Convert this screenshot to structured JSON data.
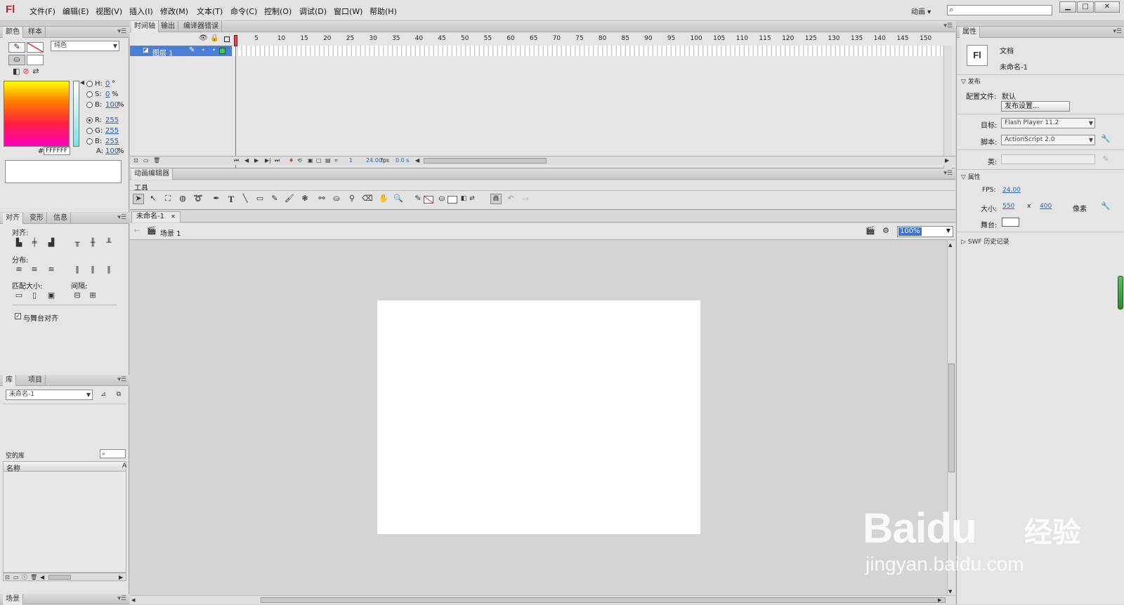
{
  "app": {
    "logo": "Fl"
  },
  "menus": [
    "文件(F)",
    "编辑(E)",
    "视图(V)",
    "插入(I)",
    "修改(M)",
    "文本(T)",
    "命令(C)",
    "控制(O)",
    "调试(D)",
    "窗口(W)",
    "帮助(H)"
  ],
  "workspace": {
    "mode": "动画 ▾"
  },
  "color_panel": {
    "tabs": [
      "颜色",
      "样本"
    ],
    "fill_type": "纯色",
    "hsb": [
      {
        "label": "H:",
        "value": "0",
        "unit": "°"
      },
      {
        "label": "S:",
        "value": "0",
        "unit": "%"
      },
      {
        "label": "B:",
        "value": "100",
        "unit": "%"
      }
    ],
    "rgb": [
      {
        "label": "R:",
        "value": "255"
      },
      {
        "label": "G:",
        "value": "255"
      },
      {
        "label": "B:",
        "value": "255"
      }
    ],
    "alpha": {
      "label": "A:",
      "value": "100",
      "unit": "%"
    },
    "hex_label": "#",
    "hex": "FFFFFF"
  },
  "align_panel": {
    "tabs": [
      "对齐",
      "变形",
      "信息"
    ],
    "align_label": "对齐:",
    "distribute_label": "分布:",
    "match_label": "匹配大小:",
    "spacing_label": "间隔:",
    "stage_checkbox": "与舞台对齐"
  },
  "library_panel": {
    "tabs": [
      "库",
      "项目"
    ],
    "doc_select": "未命名-1",
    "empty_label": "空的库",
    "col_name": "名称",
    "col_sort": "A"
  },
  "scene_panel": {
    "tab": "场景"
  },
  "timeline": {
    "tabs": [
      "时间轴",
      "输出",
      "编译器错误"
    ],
    "layer_name": "图层 1",
    "frame_ticks": [
      "1",
      "5",
      "10",
      "15",
      "20",
      "25",
      "30",
      "35",
      "40",
      "45",
      "50",
      "55",
      "60",
      "65",
      "70",
      "75",
      "80",
      "85",
      "90",
      "95",
      "100",
      "105",
      "110",
      "115",
      "120",
      "125",
      "130",
      "135",
      "140",
      "145",
      "150"
    ],
    "current_frame": "1",
    "fps": "24.00",
    "fps_unit": "fps",
    "elapsed": "0.0 s"
  },
  "motion_editor": {
    "tab": "动画编辑器"
  },
  "tools": {
    "title": "工具",
    "text_tool": "T"
  },
  "stage": {
    "doc_tab": "未命名-1",
    "scene": "场景 1",
    "zoom": "100%"
  },
  "properties": {
    "tabs": [
      "属性"
    ],
    "doc_type": "文档",
    "doc_name": "未命名-1",
    "doc_icon": "Fl",
    "publish_section": "发布",
    "profile_label": "配置文件:",
    "profile_value": "默认",
    "publish_settings_btn": "发布设置...",
    "target_label": "目标:",
    "target_value": "Flash Player 11.2",
    "script_label": "脚本:",
    "script_value": "ActionScript 2.0",
    "class_label": "类:",
    "props_section": "属性",
    "fps_label": "FPS:",
    "fps_value": "24.00",
    "size_label": "大小:",
    "width": "550",
    "times": "x",
    "height": "400",
    "unit": "像素",
    "stage_label": "舞台:",
    "swf_history": "SWF 历史记录"
  },
  "watermark": {
    "logo": "Baidu",
    "brand": "经验",
    "url": "jingyan.baidu.com"
  },
  "colors": {
    "accent_red": "#d43a3a",
    "link_blue": "#2962b8",
    "layer_select": "#4a7fd6"
  }
}
